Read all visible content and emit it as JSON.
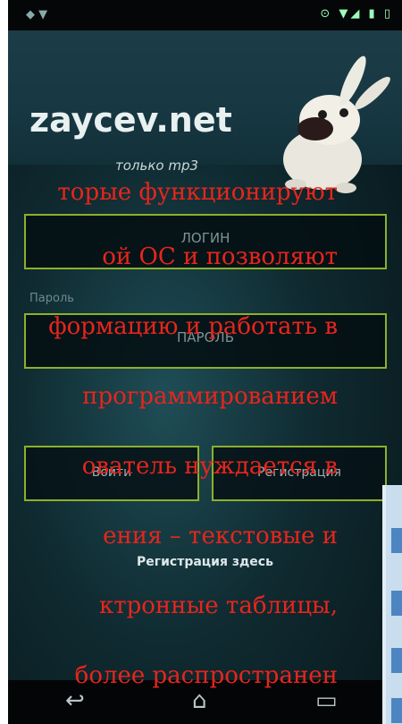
{
  "status": {
    "left": "◆ ▼",
    "right": "⊙ ▼◢ ▮ ▯"
  },
  "header": {
    "logo": "zaycev.net",
    "subtitle": "только mp3"
  },
  "login": {
    "login_placeholder": "ЛОГИН",
    "password_label": "Пароль",
    "password_placeholder": "ПАРОЛЬ",
    "left_button": "Войти",
    "right_button": "Регистрация",
    "register_link": "Регистрация здесь"
  },
  "navbar": {
    "back": "↩",
    "home": "⌂",
    "recent": "▭"
  },
  "overlay_lines": [
    "торые функционируют",
    "ой ОС и позволяют",
    "формацию и работать в",
    "программированием",
    "ователь нуждается в",
    "ения – текстовые и",
    "ктронные таблицы,",
    "более распространен"
  ],
  "colors": {
    "accent": "#8bb12a",
    "overlay_text": "#e8251c",
    "background": "#0f2a30"
  }
}
